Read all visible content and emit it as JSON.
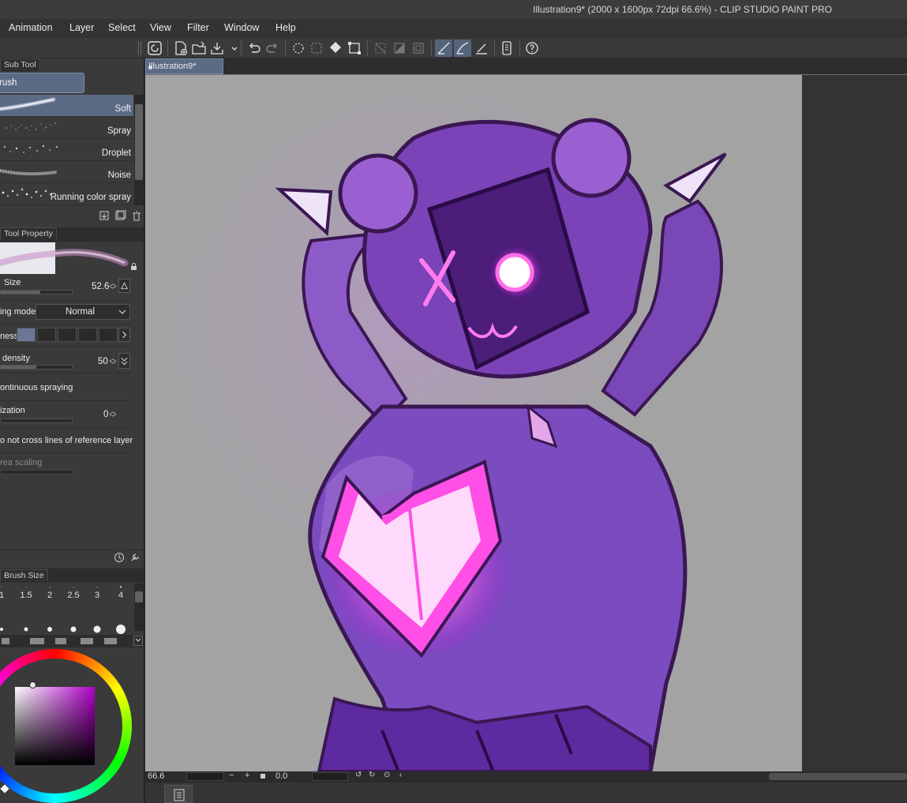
{
  "window": {
    "title": "Illustration9* (2000 x 1600px 72dpi 66.6%)  - CLIP STUDIO PAINT PRO"
  },
  "menu": [
    "Animation",
    "Layer",
    "Select",
    "View",
    "Filter",
    "Window",
    "Help"
  ],
  "toolbar": {
    "icons": [
      "clip-studio-icon",
      "new-file-icon",
      "open-file-icon",
      "save-icon",
      "undo-icon",
      "redo-icon",
      "clear-icon",
      "fill-icon",
      "transform-icon",
      "deselect-icon",
      "invert-selection-icon",
      "crop-icon",
      "snap-ruler-icon",
      "snap-special-ruler-icon",
      "snap-grid-icon",
      "phone-icon",
      "help-icon"
    ]
  },
  "subtool": {
    "tab_label": "Sub Tool",
    "group_label": "rush",
    "items": [
      {
        "label": "Soft",
        "selected": true
      },
      {
        "label": "Spray",
        "selected": false
      },
      {
        "label": "Droplet",
        "selected": false
      },
      {
        "label": "Noise",
        "selected": false
      },
      {
        "label": "Running color spray",
        "selected": false
      }
    ]
  },
  "tool_property": {
    "tab_label": "Tool Property",
    "size_label": "Size",
    "size_value": "52.6",
    "size_fraction": 0.55,
    "blend_label": "ing mode",
    "blend_value": "Normal",
    "hardness_label": "ness",
    "hardness_selected_index": 0,
    "density_label": "density",
    "density_value": "50",
    "density_fraction": 0.5,
    "continuous_label": "ontinuous spraying",
    "stabilization_label": "ization",
    "stabilization_value": "0",
    "reference_label": "o not cross lines of reference layer",
    "area_scaling_label": "rea scaling"
  },
  "brush_size": {
    "tab_label": "Brush Size",
    "sizes": [
      "1",
      "1.5",
      "2",
      "2.5",
      "3",
      "4"
    ]
  },
  "document": {
    "tab_label": "Illustration9*"
  },
  "status": {
    "zoom": "66.6",
    "rotation": "0.0"
  },
  "colors": {
    "accent": "#5b6a85",
    "canvas": "#a3a3a3",
    "main_color": "#b000c8"
  }
}
